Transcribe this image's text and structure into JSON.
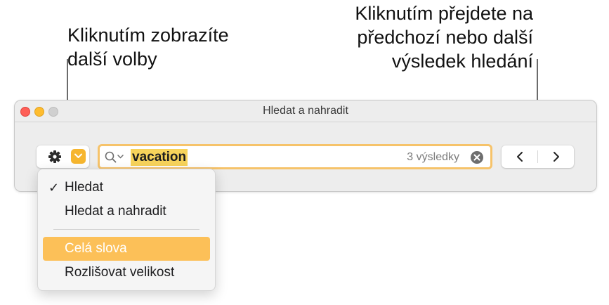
{
  "callouts": {
    "options": "Kliknutím zobrazíte\ndalší volby",
    "navigation": "Kliknutím přejdete na\npředchozí nebo další\nvýsledek hledání"
  },
  "window": {
    "title": "Hledat a nahradit"
  },
  "search": {
    "value": "vacation",
    "result_count": "3 výsledky"
  },
  "menu": {
    "items": [
      {
        "label": "Hledat",
        "checked": true
      },
      {
        "label": "Hledat a nahradit",
        "checked": false
      },
      {
        "label": "Celá slova",
        "checked": false,
        "highlighted": true
      },
      {
        "label": "Rozlišovat velikost",
        "checked": false
      }
    ],
    "checkmark": "✓"
  },
  "colors": {
    "accent": "#f6b62f",
    "highlight": "#fcc058",
    "match_highlight": "#f7d35b"
  },
  "icons": [
    "gear-icon",
    "chevron-down-icon",
    "search-icon",
    "clear-icon",
    "chevron-left-icon",
    "chevron-right-icon"
  ]
}
